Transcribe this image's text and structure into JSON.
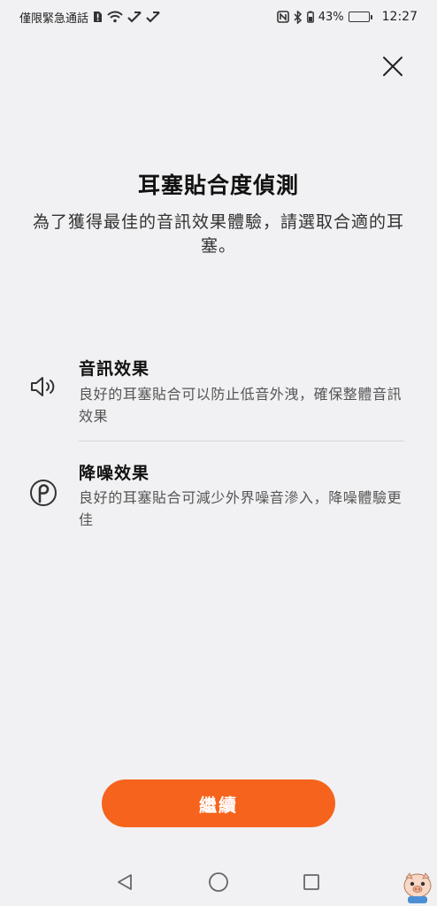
{
  "status_bar": {
    "carrier_text": "僅限緊急通話",
    "battery_percent_text": "43%",
    "battery_level": 0.43,
    "time": "12:27"
  },
  "header": {
    "title": "耳塞貼合度偵測",
    "subtitle": "為了獲得最佳的音訊效果體驗，請選取合適的耳塞。"
  },
  "features": [
    {
      "icon": "speaker-icon",
      "title": "音訊效果",
      "description": "良好的耳塞貼合可以防止低音外洩，確保整體音訊效果"
    },
    {
      "icon": "noise-cancel-icon",
      "title": "降噪效果",
      "description": "良好的耳塞貼合可減少外界噪音滲入，降噪體驗更佳"
    }
  ],
  "actions": {
    "continue_label": "繼續"
  },
  "colors": {
    "accent": "#f6631d",
    "background": "#f1f1f3"
  }
}
